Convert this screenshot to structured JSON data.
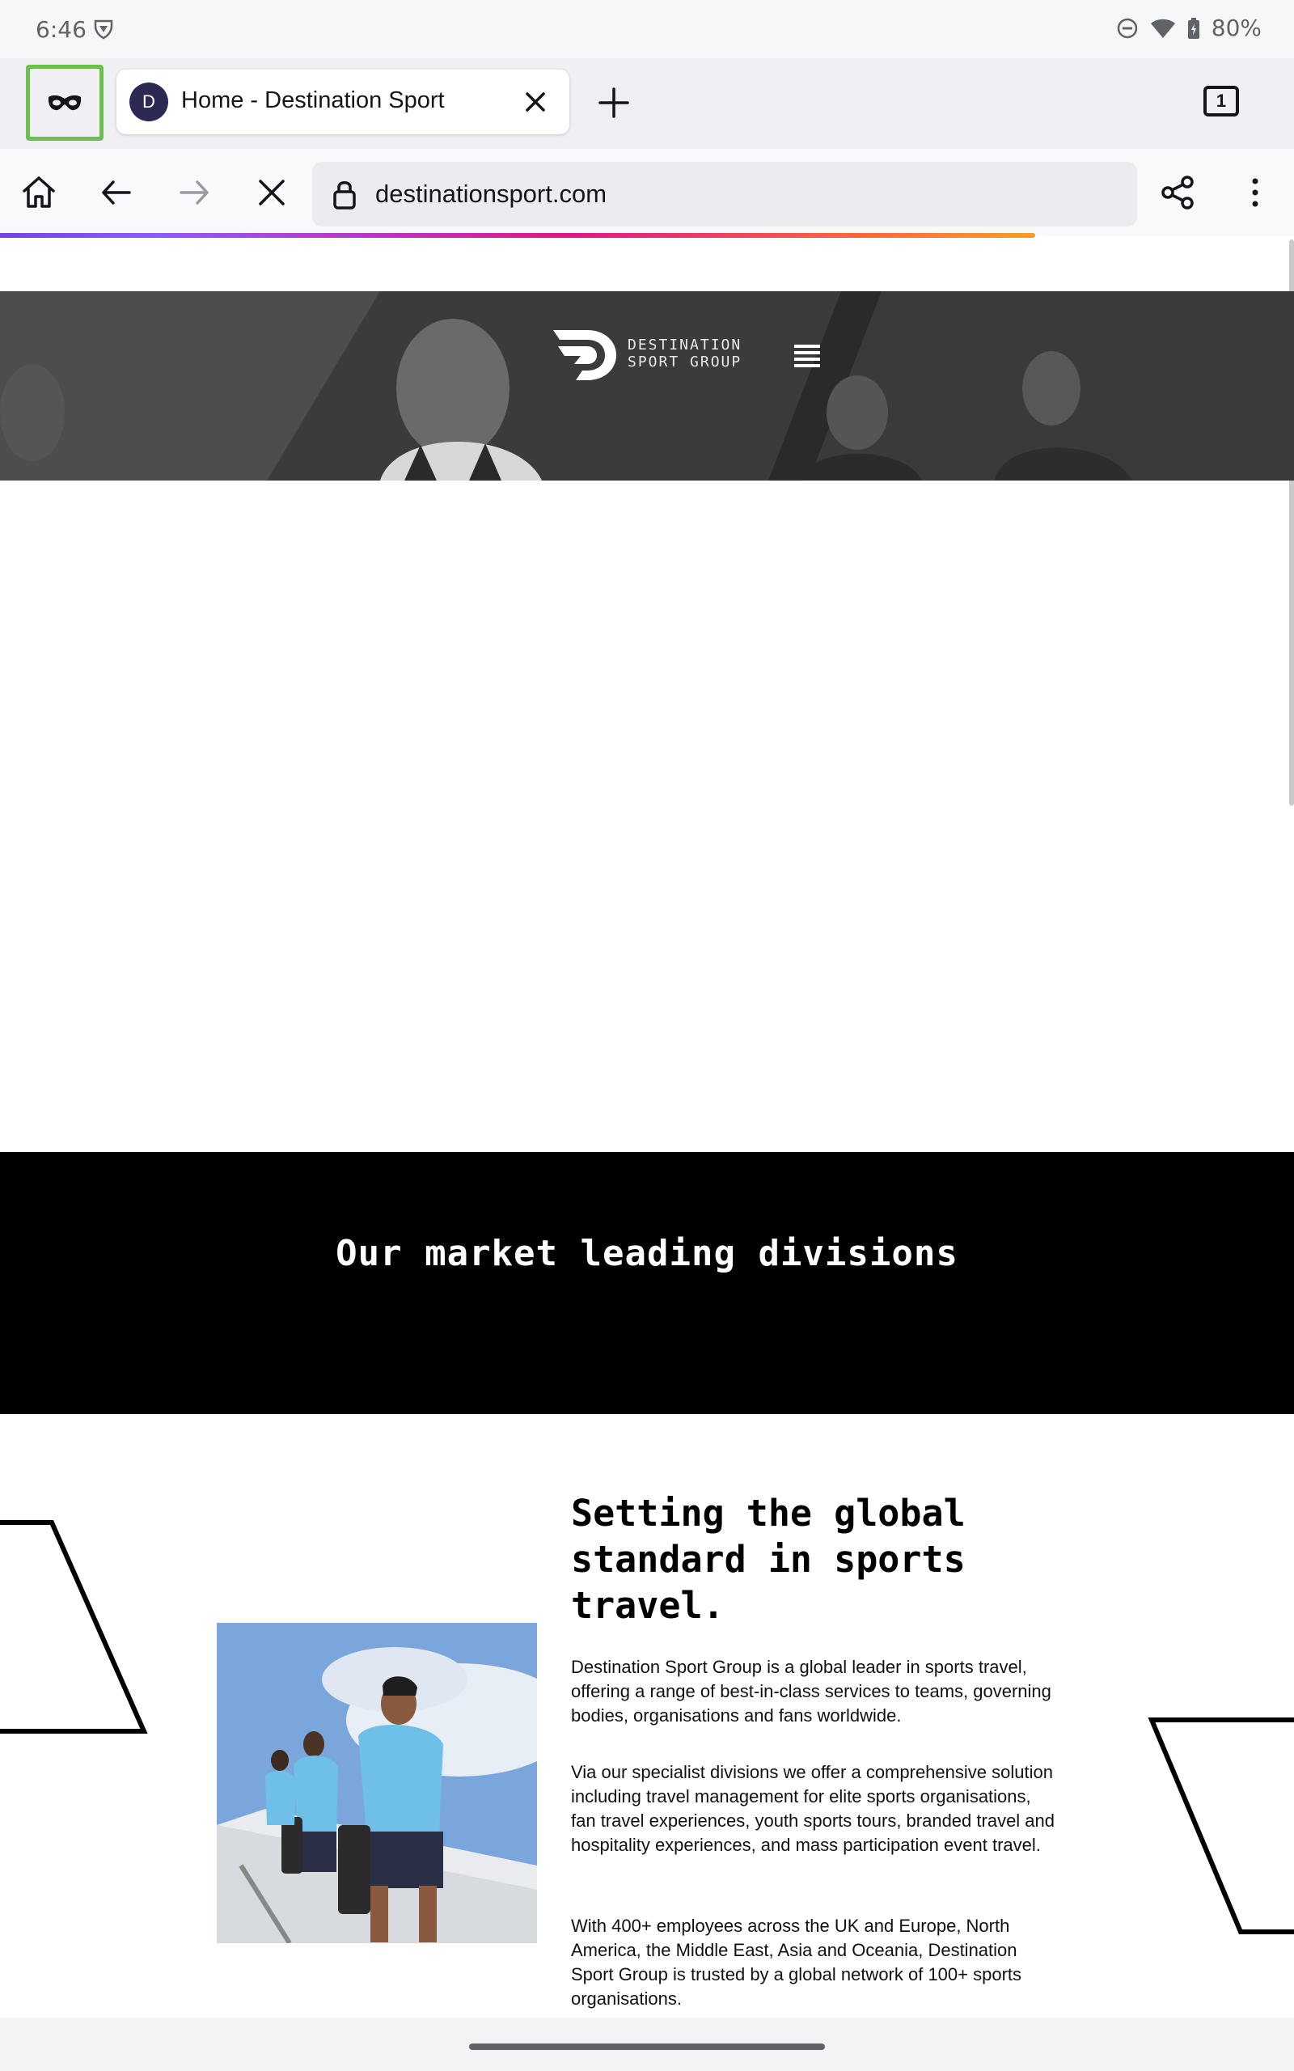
{
  "status_bar": {
    "time": "6:46",
    "battery": "80%"
  },
  "tabs": {
    "active_tab": {
      "favicon_letter": "D",
      "title": "Home - Destination Sport"
    },
    "tab_count": "1"
  },
  "toolbar": {
    "url": "destinationsport.com",
    "load_progress": 0.8
  },
  "site": {
    "logo_line1": "DESTINATION",
    "logo_line2": "SPORT GROUP",
    "divisions_title": "Our market leading divisions",
    "about_heading": "Setting the global standard in sports travel.",
    "about_paragraphs": [
      "Destination Sport Group is a global leader in sports travel, offering a range of best-in-class services to teams, governing bodies, organisations and fans worldwide.",
      "Via our specialist divisions we offer a comprehensive solution including travel management for elite sports organisations, fan travel experiences, youth sports tours, branded travel and hospitality experiences, and mass participation event travel.",
      "With 400+ employees across the UK and Europe, North America, the Middle East, Asia and Oceania, Destination Sport Group is trusted by a global network of 100+ sports organisations."
    ]
  },
  "icons": {
    "private_mode": "private-mask-icon",
    "home": "home-icon",
    "back": "back-arrow-icon",
    "forward": "forward-arrow-icon",
    "stop": "stop-loading-icon",
    "share": "share-icon",
    "menu": "more-vert-icon"
  },
  "colors": {
    "private_highlight": "#6ac149",
    "favicon_bg": "#2c2a52",
    "band_bg": "#000000"
  }
}
